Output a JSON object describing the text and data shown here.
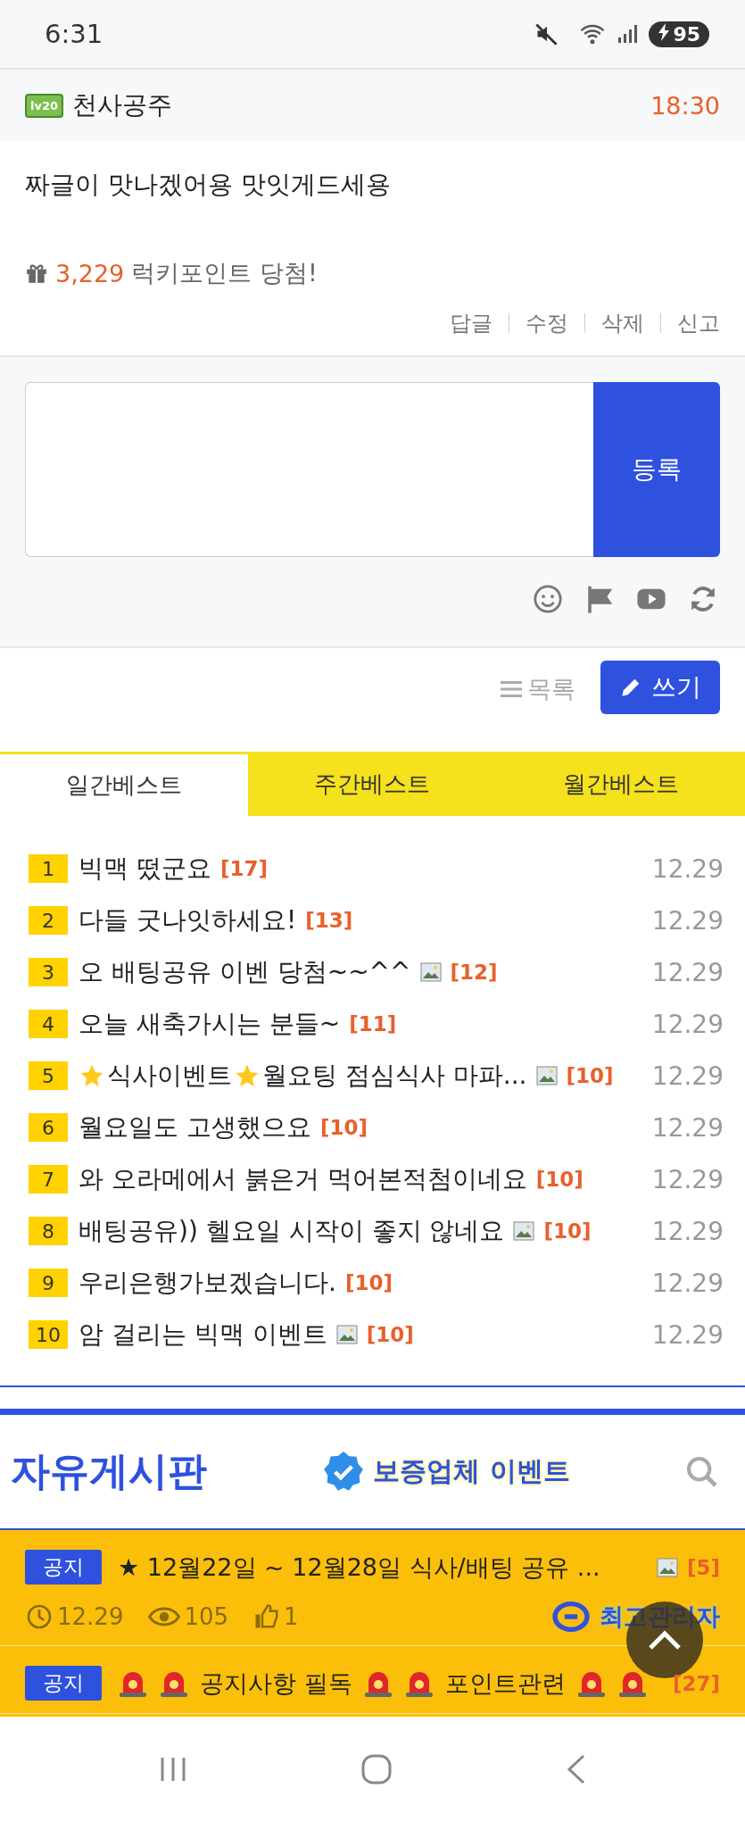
{
  "status_bar": {
    "time": "6:31",
    "battery": "95"
  },
  "comment": {
    "author": "천사공주",
    "level_badge": "lv20",
    "time": "18:30",
    "body": "짜글이 맛나겠어용 맛잇게드세용",
    "points": "3,229",
    "points_label": "럭키포인트 당첨!",
    "actions": [
      "답글",
      "수정",
      "삭제",
      "신고"
    ]
  },
  "reply_form": {
    "submit": "등록"
  },
  "board_actions": {
    "list": "목록",
    "write": "쓰기"
  },
  "best_tabs": [
    {
      "label": "일간베스트",
      "selected": true
    },
    {
      "label": "주간베스트",
      "selected": false
    },
    {
      "label": "월간베스트",
      "selected": false
    }
  ],
  "best_posts": [
    {
      "rank": "1",
      "title": [
        {
          "kind": "text",
          "text": "빅맥 떴군요"
        }
      ],
      "has_image": false,
      "comments": "[17]",
      "date": "12.29"
    },
    {
      "rank": "2",
      "title": [
        {
          "kind": "text",
          "text": "다들 굿나잇하세요!"
        }
      ],
      "has_image": false,
      "comments": "[13]",
      "date": "12.29"
    },
    {
      "rank": "3",
      "title": [
        {
          "kind": "text",
          "text": "오 배팅공유 이벤 당첨~~^^"
        }
      ],
      "has_image": true,
      "comments": "[12]",
      "date": "12.29"
    },
    {
      "rank": "4",
      "title": [
        {
          "kind": "text",
          "text": "오늘 새축가시는 분들~"
        }
      ],
      "has_image": false,
      "comments": "[11]",
      "date": "12.29"
    },
    {
      "rank": "5",
      "title": [
        {
          "kind": "star"
        },
        {
          "kind": "text",
          "text": "식사이벤트"
        },
        {
          "kind": "star"
        },
        {
          "kind": "text",
          "text": "월요팅 점심식사 마파..."
        }
      ],
      "has_image": true,
      "comments": "[10]",
      "date": "12.29"
    },
    {
      "rank": "6",
      "title": [
        {
          "kind": "text",
          "text": "월요일도 고생했으요"
        }
      ],
      "has_image": false,
      "comments": "[10]",
      "date": "12.29"
    },
    {
      "rank": "7",
      "title": [
        {
          "kind": "text",
          "text": "와 오라메에서 붉은거 먹어본적첨이네요"
        }
      ],
      "has_image": false,
      "comments": "[10]",
      "date": "12.29"
    },
    {
      "rank": "8",
      "title": [
        {
          "kind": "text",
          "text": "배팅공유)) 헬요일 시작이 좋지 않네요"
        }
      ],
      "has_image": true,
      "comments": "[10]",
      "date": "12.29"
    },
    {
      "rank": "9",
      "title": [
        {
          "kind": "text",
          "text": "우리은행가보겠습니다."
        }
      ],
      "has_image": false,
      "comments": "[10]",
      "date": "12.29"
    },
    {
      "rank": "10",
      "title": [
        {
          "kind": "text",
          "text": "암 걸리는 빅맥 이벤트"
        }
      ],
      "has_image": true,
      "comments": "[10]",
      "date": "12.29"
    }
  ],
  "board": {
    "title": "자유게시판",
    "banner": "보증업체 이벤트"
  },
  "notices": [
    {
      "tag": "공지",
      "title": [
        {
          "kind": "text",
          "text": "★ 12월22일 ~ 12월28일 식사/배팅 공유 ..."
        }
      ],
      "has_image": true,
      "comments": "[5]",
      "date": "12.29",
      "views": "105",
      "likes": "1",
      "author": "최고관리자"
    },
    {
      "tag": "공지",
      "title": [
        {
          "kind": "siren"
        },
        {
          "kind": "siren"
        },
        {
          "kind": "text",
          "text": "공지사항 필독"
        },
        {
          "kind": "siren"
        },
        {
          "kind": "siren"
        },
        {
          "kind": "text",
          "text": "포인트관련"
        },
        {
          "kind": "siren"
        },
        {
          "kind": "siren"
        }
      ],
      "has_image": false,
      "comments": "[27]"
    }
  ]
}
